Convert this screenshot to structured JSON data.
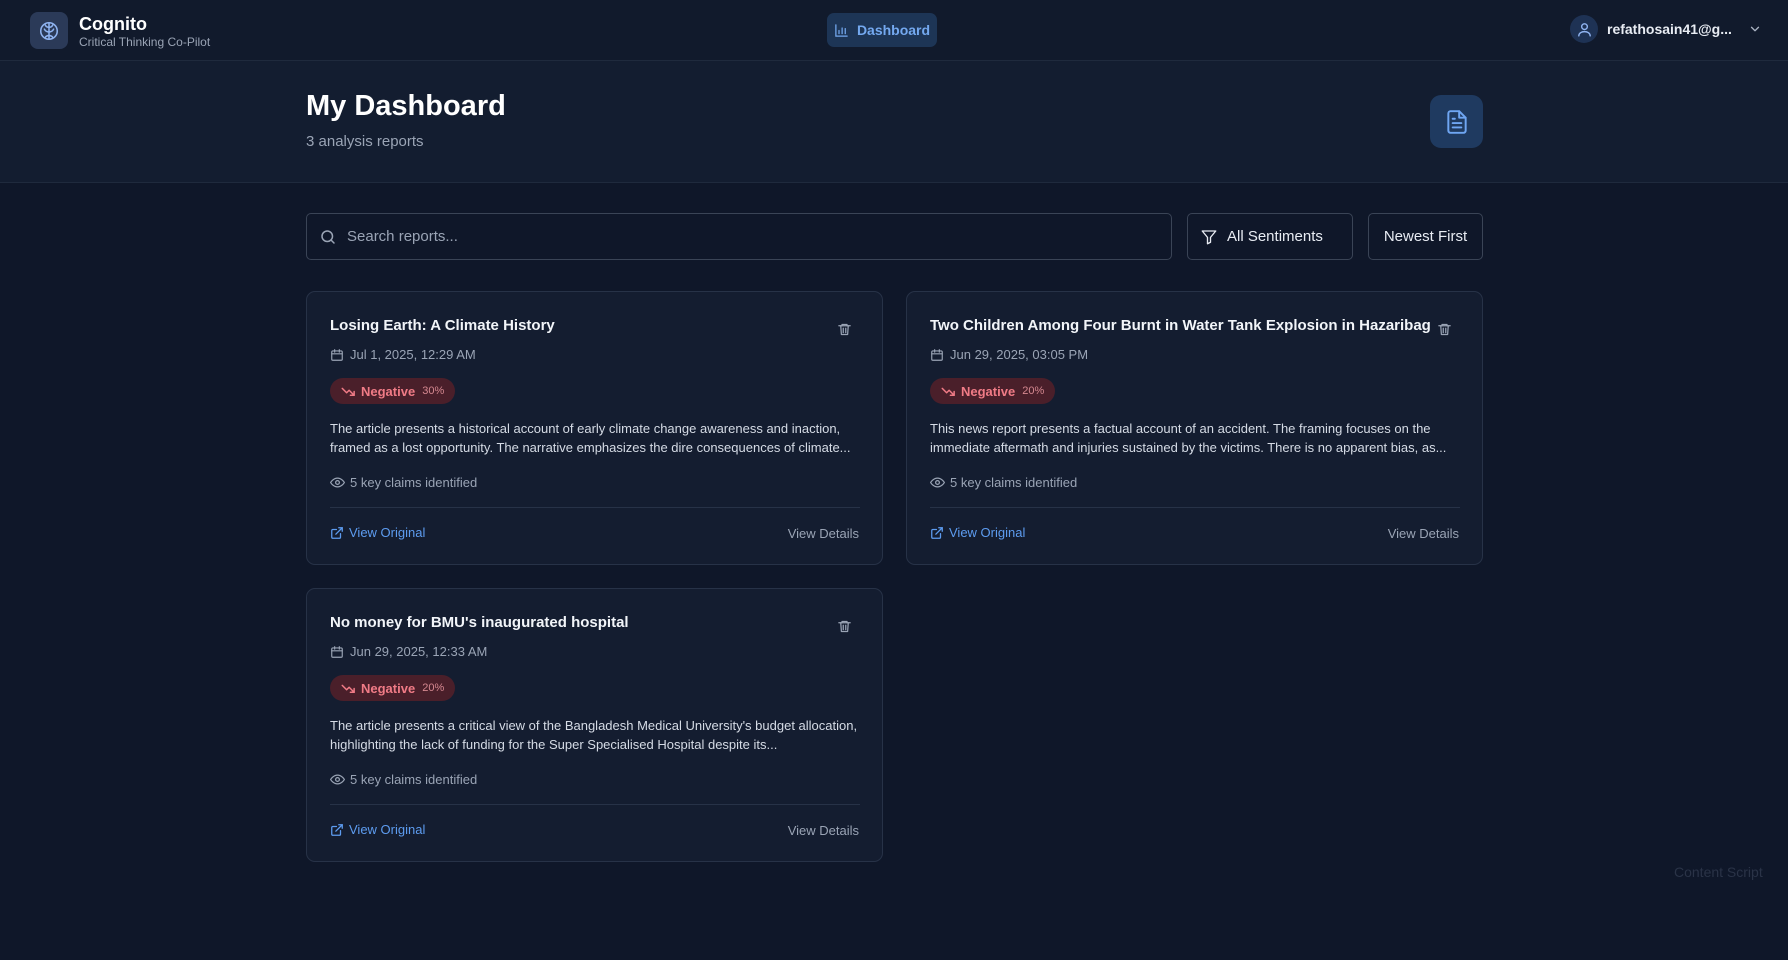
{
  "app": {
    "name": "Cognito",
    "tagline": "Critical Thinking Co-Pilot"
  },
  "nav": {
    "dashboard_label": "Dashboard"
  },
  "user": {
    "email": "refathosain41@g..."
  },
  "header": {
    "title": "My Dashboard",
    "subtitle": "3 analysis reports"
  },
  "toolbar": {
    "search_placeholder": "Search reports...",
    "search_value": "",
    "filter_label": "All Sentiments",
    "sort_label": "Newest First"
  },
  "colors": {
    "background": "#0f1729",
    "accent": "#5d9cf0",
    "negative": "#f07b86"
  },
  "reports": [
    {
      "title": "Losing Earth: A Climate History",
      "date": "Jul 1, 2025, 12:29 AM",
      "sentiment": "Negative",
      "sentiment_pct": "30%",
      "summary": "The article presents a historical account of early climate change awareness and inaction, framed as a lost opportunity. The narrative emphasizes the dire consequences of climate...",
      "claims": "5 key claims identified",
      "view_original": "View Original",
      "view_details": "View Details"
    },
    {
      "title": "Two Children Among Four Burnt in Water Tank Explosion in Hazaribagh",
      "date": "Jun 29, 2025, 03:05 PM",
      "sentiment": "Negative",
      "sentiment_pct": "20%",
      "summary": "This news report presents a factual account of an accident. The framing focuses on the immediate aftermath and injuries sustained by the victims. There is no apparent bias, as...",
      "claims": "5 key claims identified",
      "view_original": "View Original",
      "view_details": "View Details"
    },
    {
      "title": "No money for BMU's inaugurated hospital",
      "date": "Jun 29, 2025, 12:33 AM",
      "sentiment": "Negative",
      "sentiment_pct": "20%",
      "summary": "The article presents a critical view of the Bangladesh Medical University's budget allocation, highlighting the lack of funding for the Super Specialised Hospital despite its...",
      "claims": "5 key claims identified",
      "view_original": "View Original",
      "view_details": "View Details"
    }
  ],
  "footer": {
    "note": "Content Script"
  }
}
